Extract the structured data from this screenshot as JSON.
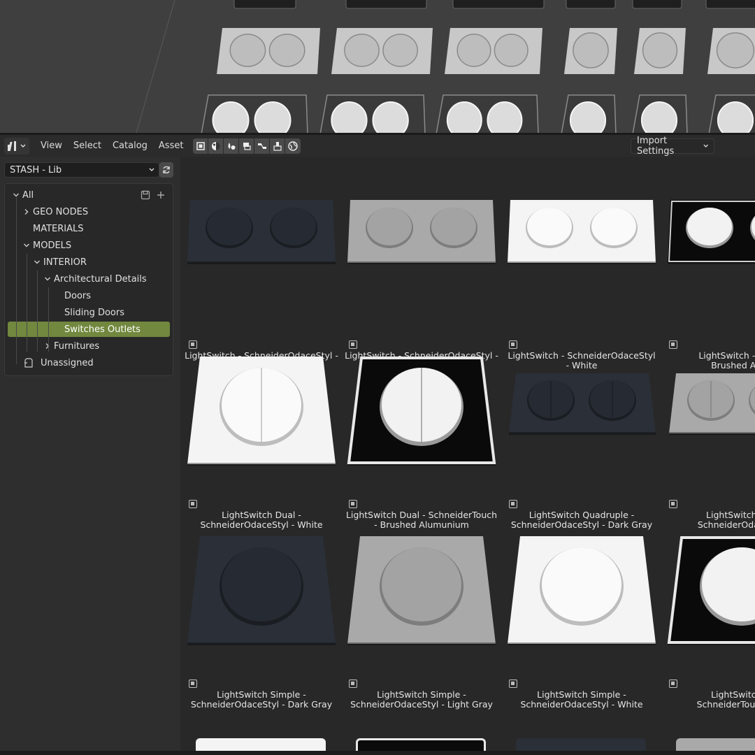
{
  "header": {
    "menus": [
      "View",
      "Select",
      "Catalog",
      "Asset"
    ],
    "filter_icons": [
      "object-filter-icon",
      "material-filter-icon",
      "world-filter-icon",
      "action-filter-icon",
      "node-group-filter-icon",
      "brush-filter-icon",
      "environment-filter-icon"
    ],
    "import_settings": "Import Settings"
  },
  "sidebar": {
    "library": "STASH - Lib",
    "tree": [
      {
        "label": "All",
        "depth": 0,
        "chevron": "down"
      },
      {
        "label": "GEO NODES",
        "depth": 1,
        "chevron": "right"
      },
      {
        "label": "MATERIALS",
        "depth": 1,
        "chevron": ""
      },
      {
        "label": "MODELS",
        "depth": 1,
        "chevron": "down"
      },
      {
        "label": "INTERIOR",
        "depth": 2,
        "chevron": "down"
      },
      {
        "label": "Architectural Details",
        "depth": 3,
        "chevron": "down"
      },
      {
        "label": "Doors",
        "depth": 4,
        "chevron": ""
      },
      {
        "label": "Sliding Doors",
        "depth": 4,
        "chevron": ""
      },
      {
        "label": "Switches Outlets",
        "depth": 4,
        "chevron": "",
        "active": true
      },
      {
        "label": "Furnitures",
        "depth": 3,
        "chevron": "right"
      },
      {
        "label": "Unassigned",
        "depth": 1,
        "chevron": "",
        "icon": true
      }
    ]
  },
  "assets": [
    {
      "name": "LightSwitch - SchneiderOdaceStyl -\nDark Gray",
      "style": "dark",
      "buttons": 2
    },
    {
      "name": "LightSwitch - SchneiderOdaceStyl -\nLight Gray",
      "style": "light",
      "buttons": 2
    },
    {
      "name": "LightSwitch - SchneiderOdaceStyl\n- White",
      "style": "white",
      "buttons": 2
    },
    {
      "name": "LightSwitch - Schne\nBrushed Alum",
      "style": "black",
      "buttons": 2
    },
    {
      "name": "LightSwitch Dual -\nSchneiderOdaceStyl - White",
      "style": "white",
      "buttons": 1,
      "split": true
    },
    {
      "name": "LightSwitch Dual - SchneiderTouch\n- Brushed Alumunium",
      "style": "black",
      "buttons": 1,
      "split": true
    },
    {
      "name": "LightSwitch Quadruple -\nSchneiderOdaceStyl - Dark Gray",
      "style": "dark",
      "buttons": 2,
      "split": true
    },
    {
      "name": "LightSwitch Qua\nSchneiderOdaceStyl",
      "style": "light",
      "buttons": 2,
      "split": true
    },
    {
      "name": "LightSwitch Simple -\nSchneiderOdaceStyl - Dark Gray",
      "style": "dark",
      "buttons": 1
    },
    {
      "name": "LightSwitch Simple -\nSchneiderOdaceStyl - Light Gray",
      "style": "light",
      "buttons": 1
    },
    {
      "name": "LightSwitch Simple -\nSchneiderOdaceStyl - White",
      "style": "white",
      "buttons": 1
    },
    {
      "name": "LightSwitch Si\nSchneiderTouch ...sh",
      "style": "black",
      "buttons": 1
    }
  ],
  "colors": {
    "accent": "#71883e",
    "dark_plate": "#2a2f38",
    "light_plate": "#a9a9a9",
    "white_plate": "#f4f4f4",
    "black_plate": "#0a0a0a"
  }
}
